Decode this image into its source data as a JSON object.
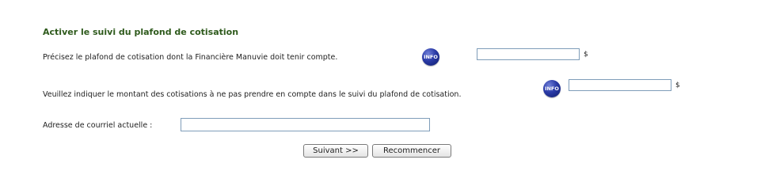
{
  "colors": {
    "accent": "#2e5a1c",
    "info_icon": "#2a3aa6"
  },
  "section": {
    "title": "Activer le suivi du plafond de cotisation"
  },
  "fields": [
    {
      "label": "Précisez le plafond de cotisation dont la Financière Manuvie doit tenir compte.",
      "info_label": "INFO",
      "value": "",
      "unit": "$"
    },
    {
      "label": "Veuillez indiquer le montant des cotisations à ne pas prendre en compte dans le suivi du plafond de cotisation.",
      "info_label": "INFO",
      "value": "",
      "unit": "$"
    },
    {
      "label": "Adresse de courriel actuelle :",
      "value": ""
    }
  ],
  "buttons": {
    "next": "Suivant >>",
    "reset": "Recommencer"
  },
  "icons": {
    "info": "info-icon"
  }
}
